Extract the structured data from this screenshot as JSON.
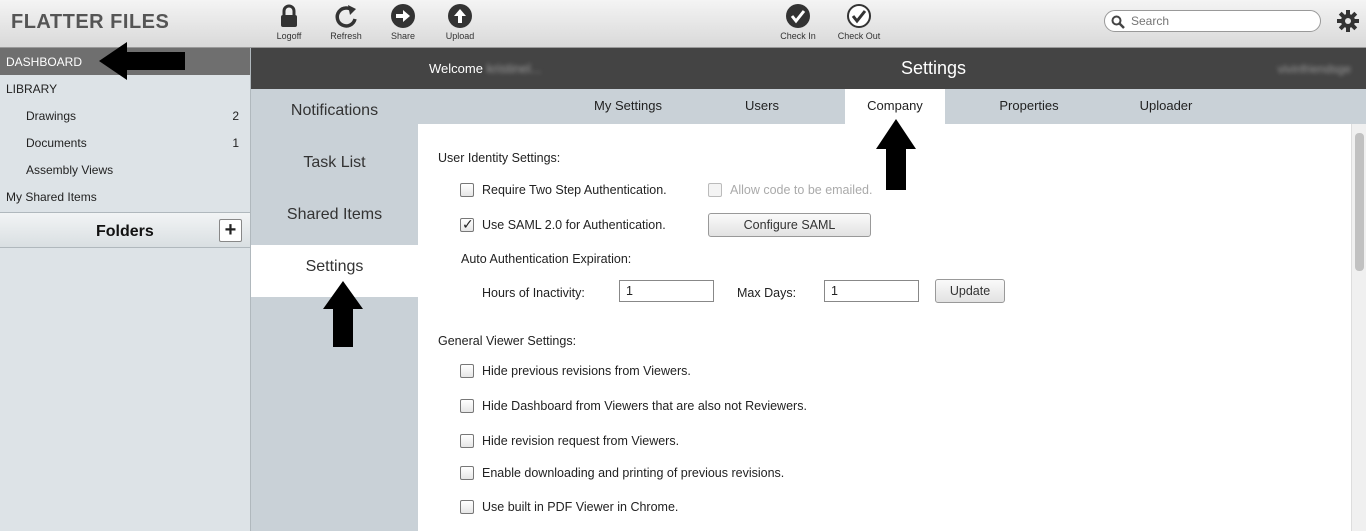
{
  "app": {
    "brand": "FLATTER FILES"
  },
  "toolbar": {
    "logoff": "Logoff",
    "refresh": "Refresh",
    "share": "Share",
    "upload": "Upload",
    "check_in": "Check In",
    "check_out": "Check Out",
    "search_placeholder": "Search"
  },
  "sidebar": {
    "dashboard": "DASHBOARD",
    "library": "LIBRARY",
    "items": [
      {
        "label": "Drawings",
        "count": "2"
      },
      {
        "label": "Documents",
        "count": "1"
      },
      {
        "label": "Assembly Views",
        "count": ""
      }
    ],
    "shared": "My Shared Items",
    "folders": "Folders",
    "add": "+"
  },
  "header": {
    "welcome": "Welcome",
    "welcome_name": "kristinel...",
    "title": "Settings",
    "user": "vivinfriendsge"
  },
  "settings_nav": [
    "Notifications",
    "Task List",
    "Shared Items",
    "Settings"
  ],
  "tabs": [
    "My Settings",
    "Users",
    "Company",
    "Properties",
    "Uploader"
  ],
  "content": {
    "identity_heading": "User Identity Settings:",
    "two_step": "Require Two Step Authentication.",
    "allow_email": "Allow code to be emailed.",
    "use_saml": "Use SAML 2.0 for Authentication.",
    "configure_saml": "Configure SAML",
    "auto_exp": "Auto Authentication Expiration:",
    "hours_label": "Hours of Inactivity:",
    "hours_value": "1",
    "max_days_label": "Max Days:",
    "max_days_value": "1",
    "update": "Update",
    "viewer_heading": "General Viewer Settings:",
    "viewer_options": [
      "Hide previous revisions from Viewers.",
      "Hide Dashboard from Viewers that are also not Reviewers.",
      "Hide revision request from Viewers.",
      "Enable downloading and printing of previous revisions.",
      "Use built in PDF Viewer in Chrome."
    ]
  }
}
